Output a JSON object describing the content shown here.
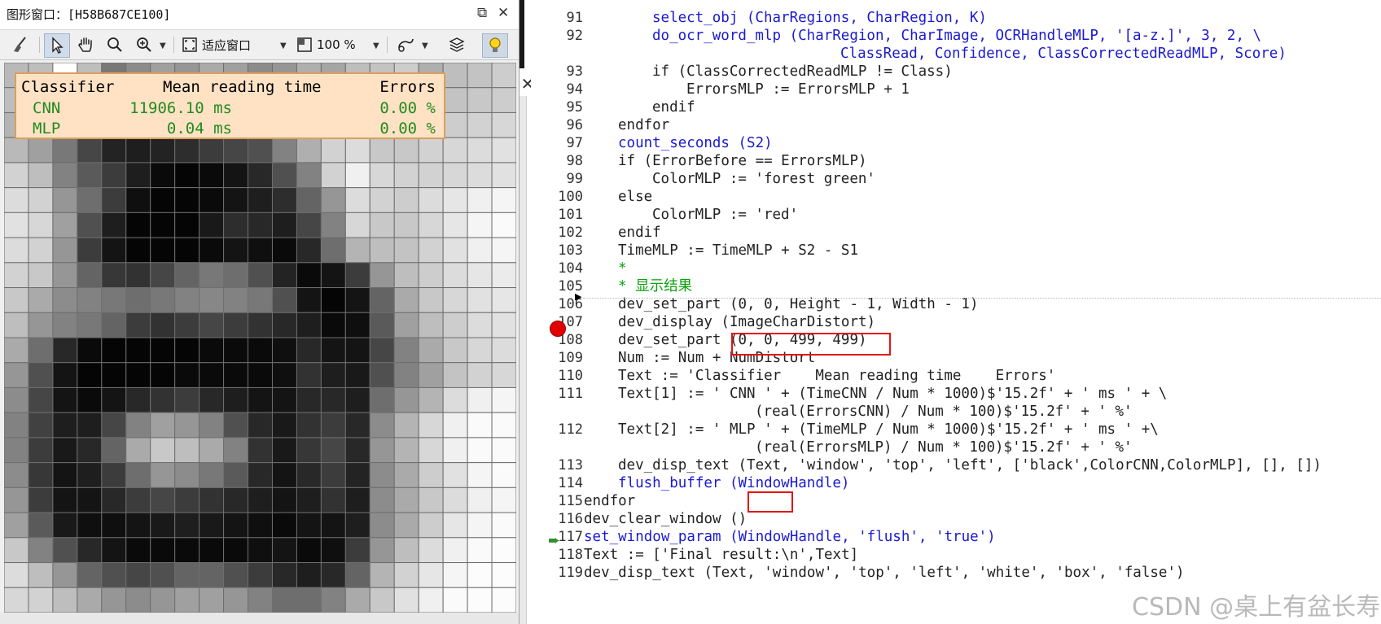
{
  "graphics_window": {
    "title": "图形窗口：[H58B687CE100]",
    "toolbar": {
      "fit_label": "适应窗口",
      "zoom_label": "100 %"
    },
    "result_text": {
      "header": {
        "classifier": "Classifier",
        "mean": "Mean reading time",
        "errors": "Errors"
      },
      "rows": [
        {
          "classifier": "CNN",
          "mean": "11906.10 ms",
          "errors": "0.00 %"
        },
        {
          "classifier": "MLP",
          "mean": "0.04 ms",
          "errors": "0.00 %"
        }
      ],
      "colors": {
        "background": "#ffe2c4",
        "border": "#d9a05c",
        "header": "#000000",
        "rows": "#228b22"
      }
    },
    "image_grid": {
      "cols": 21,
      "rows": 22,
      "gray": [
        [
          185,
          190,
          255,
          190,
          120,
          140,
          160,
          150,
          170,
          160,
          140,
          150,
          175,
          165,
          190,
          195,
          205,
          175,
          190,
          195,
          205
        ],
        [
          190,
          150,
          130,
          110,
          80,
          95,
          110,
          100,
          120,
          110,
          95,
          105,
          160,
          185,
          200,
          190,
          200,
          180,
          195,
          200,
          205
        ],
        [
          180,
          150,
          110,
          70,
          40,
          50,
          70,
          80,
          90,
          85,
          70,
          90,
          140,
          180,
          200,
          180,
          190,
          200,
          205,
          210,
          215
        ],
        [
          185,
          160,
          120,
          70,
          35,
          30,
          35,
          45,
          60,
          70,
          80,
          130,
          175,
          210,
          220,
          200,
          200,
          210,
          215,
          220,
          225
        ],
        [
          210,
          190,
          130,
          90,
          60,
          30,
          10,
          5,
          10,
          20,
          40,
          80,
          130,
          210,
          240,
          215,
          210,
          210,
          215,
          220,
          225
        ],
        [
          220,
          210,
          150,
          110,
          60,
          15,
          5,
          5,
          10,
          20,
          30,
          45,
          100,
          150,
          220,
          210,
          205,
          220,
          230,
          240,
          245
        ],
        [
          225,
          215,
          160,
          80,
          30,
          5,
          5,
          5,
          25,
          45,
          40,
          30,
          70,
          130,
          215,
          200,
          200,
          215,
          230,
          245,
          250
        ],
        [
          220,
          210,
          150,
          60,
          20,
          5,
          5,
          5,
          10,
          20,
          15,
          10,
          40,
          110,
          180,
          190,
          195,
          210,
          225,
          240,
          245
        ],
        [
          210,
          200,
          150,
          100,
          55,
          50,
          70,
          100,
          120,
          110,
          80,
          35,
          10,
          20,
          60,
          150,
          190,
          205,
          220,
          230,
          235
        ],
        [
          200,
          170,
          140,
          130,
          120,
          110,
          120,
          130,
          135,
          130,
          120,
          80,
          20,
          5,
          20,
          100,
          170,
          200,
          215,
          225,
          230
        ],
        [
          190,
          150,
          130,
          120,
          100,
          60,
          50,
          60,
          70,
          60,
          50,
          40,
          30,
          10,
          15,
          90,
          160,
          190,
          205,
          220,
          225
        ],
        [
          170,
          110,
          40,
          10,
          5,
          5,
          5,
          5,
          10,
          10,
          10,
          15,
          40,
          20,
          20,
          70,
          130,
          170,
          200,
          215,
          220
        ],
        [
          150,
          80,
          20,
          5,
          5,
          5,
          5,
          10,
          10,
          10,
          10,
          15,
          50,
          30,
          25,
          80,
          130,
          160,
          195,
          210,
          215
        ],
        [
          140,
          70,
          20,
          10,
          20,
          40,
          50,
          60,
          40,
          30,
          20,
          20,
          40,
          40,
          30,
          110,
          150,
          180,
          220,
          240,
          245
        ],
        [
          130,
          65,
          30,
          30,
          70,
          130,
          160,
          150,
          130,
          80,
          40,
          25,
          50,
          60,
          40,
          140,
          180,
          215,
          240,
          250,
          250
        ],
        [
          130,
          60,
          25,
          40,
          100,
          170,
          200,
          190,
          170,
          130,
          50,
          25,
          55,
          70,
          40,
          150,
          180,
          215,
          240,
          250,
          250
        ],
        [
          140,
          55,
          20,
          30,
          60,
          110,
          150,
          140,
          120,
          90,
          40,
          20,
          40,
          60,
          35,
          140,
          170,
          205,
          225,
          245,
          250
        ],
        [
          150,
          60,
          20,
          20,
          40,
          60,
          70,
          60,
          50,
          40,
          30,
          20,
          30,
          50,
          30,
          140,
          170,
          200,
          220,
          240,
          245
        ],
        [
          160,
          90,
          25,
          15,
          15,
          20,
          25,
          30,
          25,
          20,
          15,
          10,
          20,
          20,
          30,
          140,
          170,
          205,
          230,
          245,
          250
        ],
        [
          200,
          130,
          80,
          40,
          20,
          10,
          10,
          10,
          10,
          10,
          15,
          20,
          10,
          15,
          60,
          150,
          190,
          220,
          240,
          250,
          252
        ],
        [
          220,
          190,
          150,
          100,
          80,
          70,
          80,
          100,
          100,
          80,
          60,
          40,
          30,
          40,
          100,
          180,
          210,
          230,
          245,
          252,
          252
        ],
        [
          215,
          210,
          190,
          170,
          150,
          140,
          150,
          160,
          160,
          150,
          130,
          110,
          110,
          130,
          170,
          200,
          225,
          240,
          250,
          252,
          252
        ]
      ]
    }
  },
  "editor": {
    "lines": [
      {
        "n": "91",
        "indent": 2,
        "tokens": [
          {
            "t": "select_obj",
            "k": "op"
          },
          {
            "t": " (CharRegions, CharRegion, K)",
            "k": "op"
          }
        ]
      },
      {
        "n": "92",
        "indent": 2,
        "tokens": [
          {
            "t": "do_ocr_word_mlp",
            "k": "op"
          },
          {
            "t": " (CharRegion, CharImage, OCRHandleMLP, '[a-z.]', 3, 2, \\",
            "k": "op"
          }
        ]
      },
      {
        "n": "",
        "indent": 0,
        "col": 30,
        "tokens": [
          {
            "t": "ClassRead, Confidence, ClassCorrectedReadMLP, Score)",
            "k": "op"
          }
        ]
      },
      {
        "n": "93",
        "indent": 2,
        "tokens": [
          {
            "t": "if (ClassCorrectedReadMLP != Class)",
            "k": ""
          }
        ]
      },
      {
        "n": "94",
        "indent": 3,
        "tokens": [
          {
            "t": "ErrorsMLP := ErrorsMLP + 1",
            "k": ""
          }
        ]
      },
      {
        "n": "95",
        "indent": 2,
        "tokens": [
          {
            "t": "endif",
            "k": ""
          }
        ]
      },
      {
        "n": "96",
        "indent": 1,
        "tokens": [
          {
            "t": "endfor",
            "k": ""
          }
        ]
      },
      {
        "n": "97",
        "indent": 1,
        "tokens": [
          {
            "t": "count_seconds (S2)",
            "k": "op"
          }
        ]
      },
      {
        "n": "98",
        "indent": 1,
        "tokens": [
          {
            "t": "if (ErrorBefore == ErrorsMLP)",
            "k": ""
          }
        ]
      },
      {
        "n": "99",
        "indent": 2,
        "tokens": [
          {
            "t": "ColorMLP := 'forest green'",
            "k": ""
          }
        ]
      },
      {
        "n": "100",
        "indent": 1,
        "tokens": [
          {
            "t": "else",
            "k": ""
          }
        ]
      },
      {
        "n": "101",
        "indent": 2,
        "tokens": [
          {
            "t": "ColorMLP := 'red'",
            "k": ""
          }
        ]
      },
      {
        "n": "102",
        "indent": 1,
        "tokens": [
          {
            "t": "endif",
            "k": ""
          }
        ]
      },
      {
        "n": "103",
        "indent": 1,
        "tokens": [
          {
            "t": "TimeMLP := TimeMLP + S2 - S1",
            "k": ""
          }
        ]
      },
      {
        "n": "104",
        "indent": 1,
        "tokens": [
          {
            "t": "*",
            "k": "cm"
          }
        ]
      },
      {
        "n": "105",
        "indent": 1,
        "tokens": [
          {
            "t": "* 显示结果",
            "k": "cm"
          }
        ]
      },
      {
        "n": "106",
        "indent": 1,
        "tokens": [
          {
            "t": "dev_set_part (0, 0, Height - 1, Width - 1)",
            "k": ""
          }
        ]
      },
      {
        "n": "107",
        "indent": 1,
        "tokens": [
          {
            "t": "dev_display (ImageCharDistort)",
            "k": ""
          }
        ]
      },
      {
        "n": "108",
        "indent": 1,
        "tokens": [
          {
            "t": "dev_set_part (0, 0, 499, 499)",
            "k": ""
          }
        ]
      },
      {
        "n": "109",
        "indent": 1,
        "tokens": [
          {
            "t": "Num := Num + NumDistort",
            "k": ""
          }
        ]
      },
      {
        "n": "110",
        "indent": 1,
        "tokens": [
          {
            "t": "Text := 'Classifier    Mean reading time    Errors'",
            "k": ""
          }
        ]
      },
      {
        "n": "111",
        "indent": 1,
        "tokens": [
          {
            "t": "Text[1] := ' CNN ' + (TimeCNN / Num * 1000)$'15.2f' + ' ms ' + \\",
            "k": ""
          }
        ]
      },
      {
        "n": "",
        "indent": 0,
        "col": 20,
        "tokens": [
          {
            "t": "(real(ErrorsCNN) / Num * 100)$'15.2f' + ' %'",
            "k": ""
          }
        ]
      },
      {
        "n": "112",
        "indent": 1,
        "tokens": [
          {
            "t": "Text[2] := ' MLP ' + (TimeMLP / Num * 1000)$'15.2f' + ' ms ' +\\",
            "k": ""
          }
        ]
      },
      {
        "n": "",
        "indent": 0,
        "col": 20,
        "tokens": [
          {
            "t": "(real(ErrorsMLP) / Num * 100)$'15.2f' + ' %'",
            "k": ""
          }
        ]
      },
      {
        "n": "113",
        "indent": 1,
        "tokens": [
          {
            "t": "dev_disp_text (Text, 'window', 'top', 'left', ['black',ColorCNN,ColorMLP], [], [])",
            "k": ""
          }
        ]
      },
      {
        "n": "114",
        "indent": 1,
        "tokens": [
          {
            "t": "flush_buffer (WindowHandle)",
            "k": "op"
          }
        ]
      },
      {
        "n": "115",
        "indent": 0,
        "tokens": [
          {
            "t": "endfor",
            "k": ""
          }
        ]
      },
      {
        "n": "116",
        "indent": 0,
        "tokens": [
          {
            "t": "dev_clear_window ()",
            "k": ""
          }
        ]
      },
      {
        "n": "117",
        "indent": 0,
        "tokens": [
          {
            "t": "set_window_param (WindowHandle, 'flush', 'true')",
            "k": "op"
          }
        ]
      },
      {
        "n": "118",
        "indent": 0,
        "tokens": [
          {
            "t": "Text := ['Final result:\\n',Text]",
            "k": ""
          }
        ]
      },
      {
        "n": "119",
        "indent": 0,
        "tokens": [
          {
            "t": "dev_disp_text (Text, 'window', 'top', 'left', 'white', 'box', 'false')",
            "k": ""
          }
        ]
      }
    ],
    "breakpoint_line": "106",
    "pc_line": "115",
    "highlight_color": "#e51414",
    "colors": {
      "operator": "#1a1ad0",
      "comment": "#0aa00a",
      "text": "#222222"
    }
  },
  "watermark": "CSDN @桌上有盆长寿花"
}
